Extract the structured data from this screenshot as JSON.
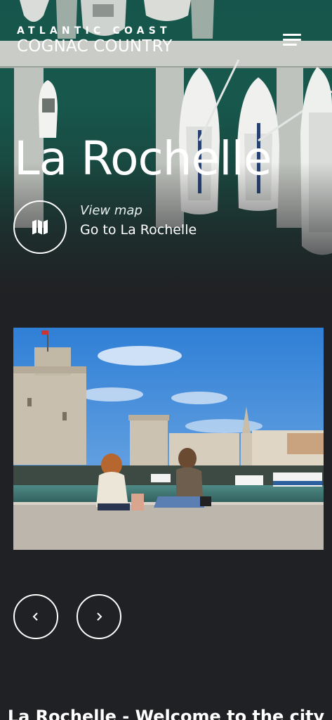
{
  "header": {
    "logo_line1": "ATLANTIC COAST",
    "logo_line2": "COGNAC COUNTRY",
    "menu_icon": "hamburger-menu-icon"
  },
  "hero": {
    "title": "La Rochelle",
    "map_icon": "map-icon",
    "view_map_label": "View map",
    "go_to_label": "Go to La Rochelle"
  },
  "gallery": {
    "prev_icon": "chevron-left-icon",
    "next_icon": "chevron-right-icon"
  },
  "section": {
    "heading": "La Rochelle - Welcome to the city"
  },
  "colors": {
    "background": "#202124",
    "harbour_water": "#1a5a4f",
    "sky": "#3b86d8"
  }
}
